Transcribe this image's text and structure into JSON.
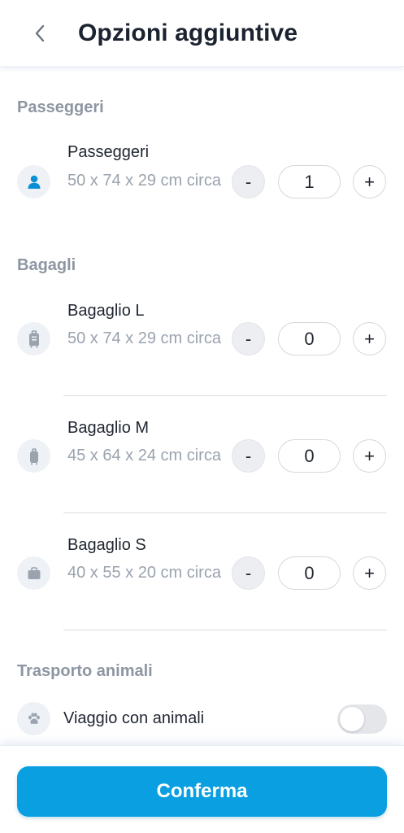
{
  "header": {
    "title": "Opzioni aggiuntive",
    "back_icon": "chevron-left-icon"
  },
  "sections": {
    "passengers": {
      "title": "Passeggeri",
      "item": {
        "name": "Passeggeri",
        "dims": "50 x 74 x 29 cm circa",
        "quantity": "1",
        "icon": "person-icon"
      }
    },
    "luggage": {
      "title": "Bagagli",
      "items": [
        {
          "name": "Bagaglio L",
          "dims": "50 x 74 x 29 cm circa",
          "quantity": "0",
          "icon": "large-suitcase-icon"
        },
        {
          "name": "Bagaglio M",
          "dims": "45 x 64 x 24 cm circa",
          "quantity": "0",
          "icon": "medium-suitcase-icon"
        },
        {
          "name": "Bagaglio S",
          "dims": "40 x 55 x 20 cm circa",
          "quantity": "0",
          "icon": "small-bag-icon"
        }
      ]
    },
    "pets": {
      "title": "Trasporto animali",
      "item": {
        "label": "Viaggio con animali",
        "enabled": false,
        "icon": "paw-icon"
      }
    }
  },
  "stepper": {
    "minus_label": "-",
    "plus_label": "+"
  },
  "footer": {
    "confirm_label": "Conferma"
  },
  "colors": {
    "accent": "#0a9fe0",
    "passenger_icon": "#0a8fd4",
    "muted_icon": "#9aa3ae"
  }
}
